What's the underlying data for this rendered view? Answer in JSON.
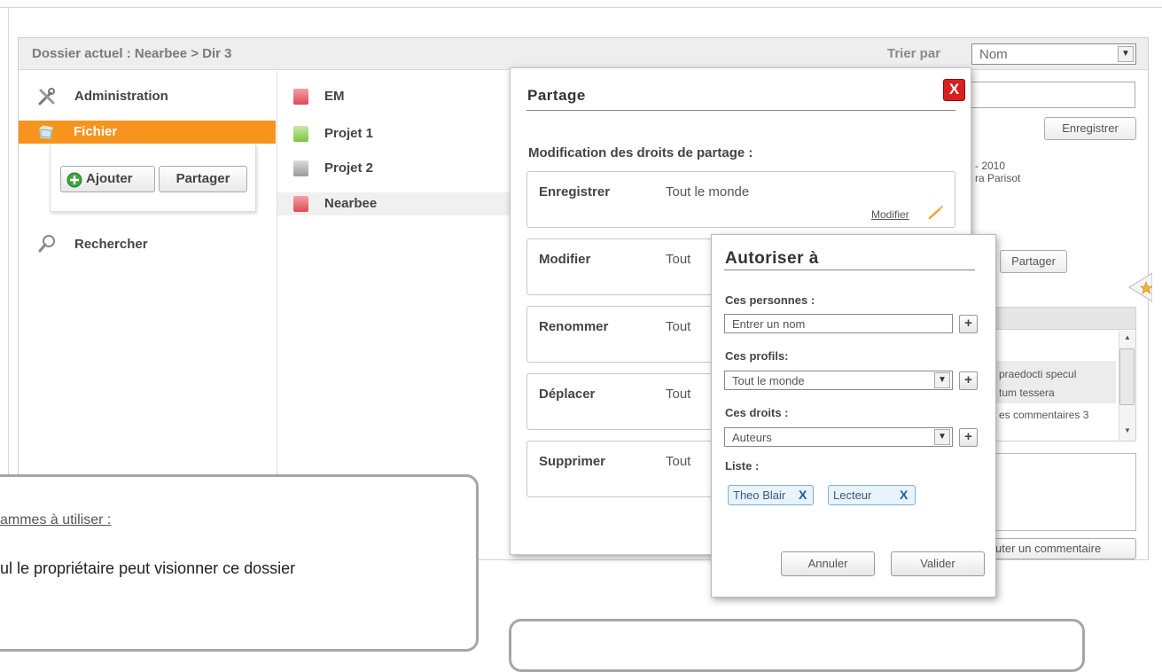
{
  "header": {
    "path": "Dossier actuel : Nearbee > Dir 3",
    "sort_label": "Trier par",
    "sort_value": "Nom"
  },
  "nav": {
    "items": [
      {
        "label": "Administration",
        "icon": "tools-icon"
      },
      {
        "label": "Fichier",
        "icon": "folder-icon",
        "active": true
      },
      {
        "label": "Rechercher",
        "icon": "search-icon"
      }
    ],
    "actions": {
      "add_label": "Ajouter",
      "share_label": "Partager"
    }
  },
  "files": [
    {
      "name": "EM",
      "color": "#e04858"
    },
    {
      "name": "Projet 1",
      "color": "#7cc444"
    },
    {
      "name": "Projet 2",
      "color": "#9a9a9a"
    },
    {
      "name": "Nearbee",
      "color": "#e04858",
      "selected": true
    }
  ],
  "details": {
    "save_label": "Enregistrer",
    "date_fragment": "- 2010",
    "author_fragment": "ra Parisot",
    "share_label": "Partager",
    "comments": {
      "line1": "praedocti specul",
      "line2": "tum tessera",
      "line3": "es commentaires 3"
    },
    "add_comment_label": "uter un commentaire"
  },
  "partage": {
    "title": "Partage",
    "close_label": "X",
    "subtitle": "Modification des droits de partage :",
    "permissions": [
      {
        "name": "Enregistrer",
        "value": "Tout le monde"
      },
      {
        "name": "Modifier",
        "value": "Tout"
      },
      {
        "name": "Renommer",
        "value": "Tout"
      },
      {
        "name": "Déplacer",
        "value": "Tout"
      },
      {
        "name": "Supprimer",
        "value": "Tout"
      }
    ],
    "modify_link": "Modifier"
  },
  "autoriser": {
    "title": "Autoriser à",
    "persons_label": "Ces personnes :",
    "persons_placeholder": "Entrer un nom",
    "profiles_label": "Ces profils:",
    "profiles_value": "Tout le monde",
    "rights_label": "Ces droits :",
    "rights_value": "Auteurs",
    "list_label": "Liste :",
    "tags": [
      {
        "label": "Theo Blair",
        "remove": "X"
      },
      {
        "label": "Lecteur",
        "remove": "X"
      }
    ],
    "plus": "+",
    "cancel_label": "Annuler",
    "validate_label": "Valider"
  },
  "notes": {
    "left_heading": "ammes à utiliser :",
    "left_text": "ul le propriétaire peut visionner ce dossier"
  },
  "colors": {
    "accent": "#f7941d",
    "close": "#d92020",
    "tag_border": "#7ab0d6"
  }
}
